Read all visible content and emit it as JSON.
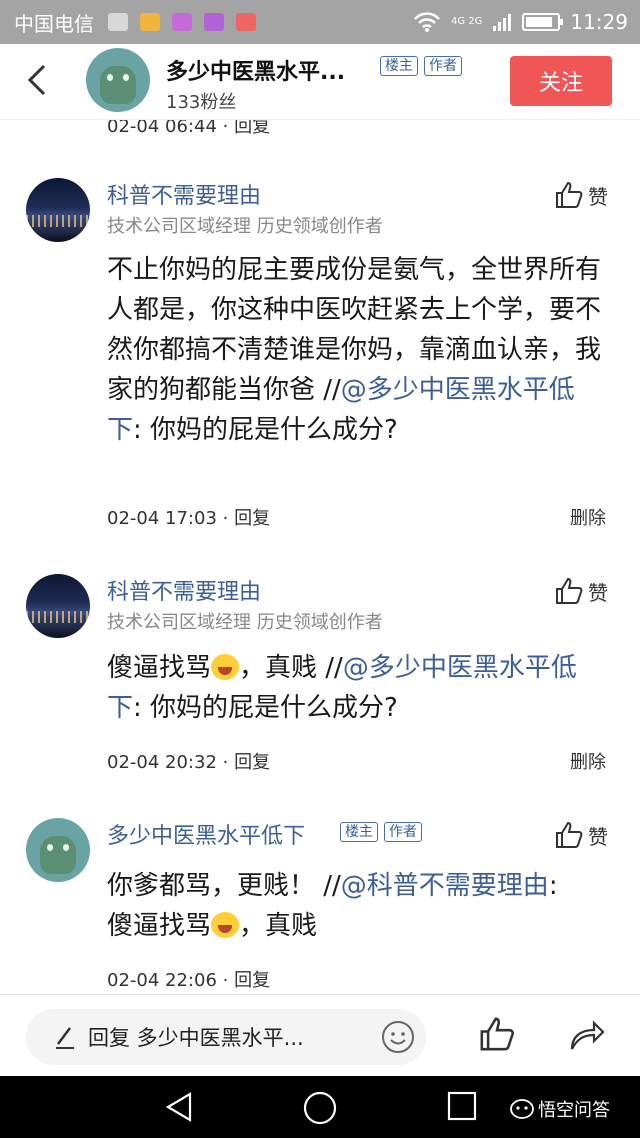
{
  "status_bar": {
    "carrier": "中国电信",
    "network": "4G 2G",
    "time": "11:29",
    "battery_level": 0.85
  },
  "header": {
    "title": "多少中医黑水平...",
    "tags": [
      "楼主",
      "作者"
    ],
    "fans": "133粉丝",
    "follow_label": "关注"
  },
  "remnant": "02-04 06:44 · 回复",
  "comments": [
    {
      "name": "科普不需要理由",
      "subtitle": "技术公司区域经理 历史领域创作者",
      "like_label": "赞",
      "text": "不止你妈的屁主要成份是氨气，全世界所有人都是，你这种中医吹赶紧去上个学，要不然你都搞不清楚谁是你妈，靠滴血认亲，我家的狗都能当你爸 //",
      "mention": "@多少中医黑水平低下",
      "quote": ": 你妈的屁是什么成分?",
      "meta": "02-04 17:03 · 回复",
      "delete_label": "删除"
    },
    {
      "name": "科普不需要理由",
      "subtitle": "技术公司区域经理 历史领域创作者",
      "like_label": "赞",
      "text_before": "傻逼找骂",
      "text_after": "，真贱 //",
      "mention": "@多少中医黑水平低下",
      "quote": ": 你妈的屁是什么成分?",
      "meta": "02-04 20:32 · 回复",
      "delete_label": "删除"
    },
    {
      "name": "多少中医黑水平低下",
      "tags": [
        "楼主",
        "作者"
      ],
      "like_label": "赞",
      "text": "你爹都骂，更贱！ //",
      "mention": "@科普不需要理由",
      "line2_before": "傻逼找骂",
      "line2_after": "，真贱",
      "meta": "02-04 22:06 · 回复"
    }
  ],
  "bottom_bar": {
    "reply_placeholder": "回复 多少中医黑水平..."
  },
  "watermark": "悟空问答"
}
